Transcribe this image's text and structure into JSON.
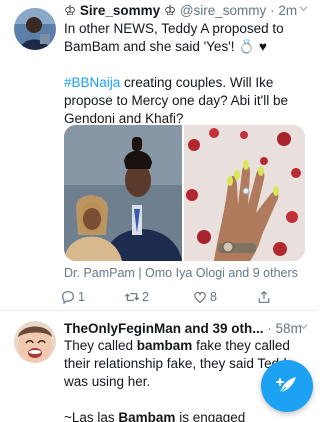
{
  "tweets": [
    {
      "header": {
        "badge_left": "♔",
        "name": "Sire_sommy",
        "badge_right": "♔",
        "handle": "@sire_sommy",
        "separator": "·",
        "time": "2m"
      },
      "text": {
        "l1": "In other NEWS, Teddy A proposed to",
        "l2_mention": "BamBam",
        "l2_rest": " and she said 'Yes'! ",
        "l2_emoji": "💍 ♥",
        "l3_hashtag": "#BBNaija",
        "l3_rest": " creating couples. Will Ike",
        "l4": "propose to Mercy one day? Abi it'll be",
        "l5": "Gendoni and Khafi?"
      },
      "mentions": "Dr. PamPam | Omo Iya Ologi and 9 others",
      "actions": {
        "replies": "1",
        "retweets": "2",
        "likes": "8"
      }
    },
    {
      "header": {
        "name": "TheOnlyFeginMan and 39 oth...",
        "separator": "·",
        "time": "58m"
      },
      "text": {
        "l1_a": "They called ",
        "l1_bold": "bambam",
        "l1_b": " fake they called",
        "l2": "their relationship fake, they said Teddy",
        "l3": "was using her.",
        "l5_a": "~Las las ",
        "l5_bold": "Bambam",
        "l5_b": " is engaged"
      }
    }
  ],
  "colors": {
    "accent": "#1da1f2",
    "muted": "#657786",
    "text": "#14171a",
    "divider": "#e6ecf0"
  },
  "icons": [
    "reply-icon",
    "retweet-icon",
    "like-icon",
    "share-icon",
    "chevron-down-icon",
    "compose-tweet-icon"
  ]
}
